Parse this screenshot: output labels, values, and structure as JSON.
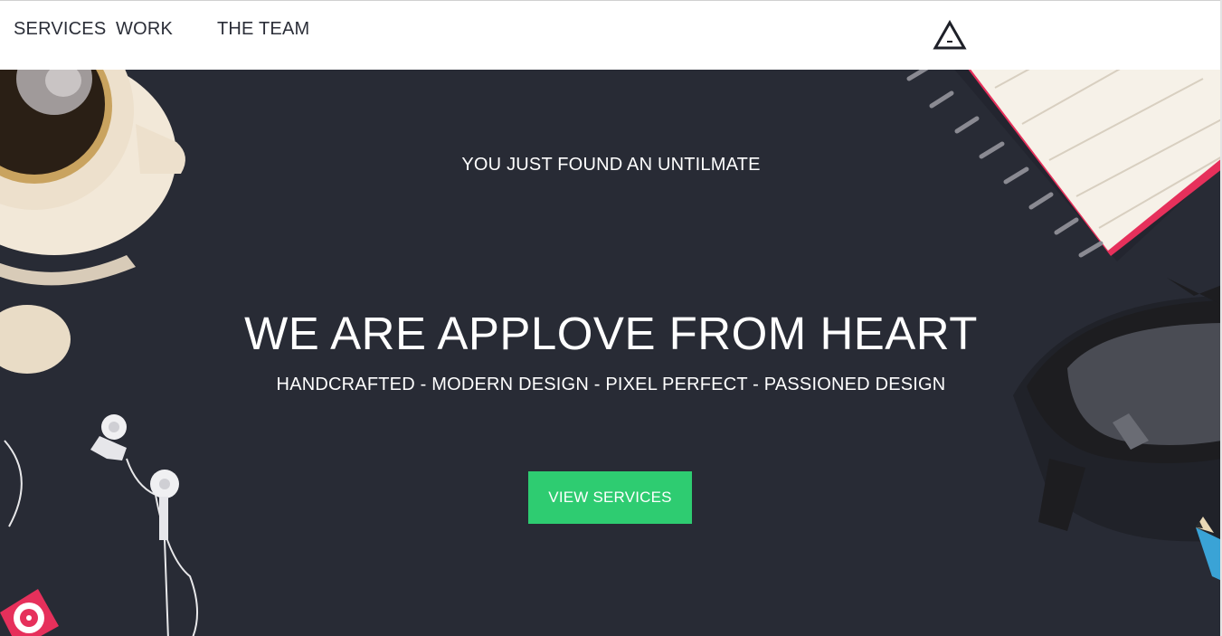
{
  "nav": {
    "items": [
      {
        "label": "SERVICES"
      },
      {
        "label": "WORK"
      },
      {
        "label": "THE TEAM"
      }
    ],
    "logo_icon": "triangle-logo-icon"
  },
  "hero": {
    "tagline": "YOU JUST FOUND AN UNTILMATE",
    "headline": "WE ARE APPLOVE FROM HEART",
    "subheading": "HANDCRAFTED - MODERN DESIGN - PIXEL PERFECT - PASSIONED DESIGN",
    "cta_label": "VIEW SERVICES",
    "background_color": "#282b35",
    "cta_color": "#2ecc71",
    "decorations": [
      "coffee-cup-icon",
      "spiral-notebook-icon",
      "eyeglasses-icon",
      "earphones-icon",
      "pencil-icon",
      "music-player-icon"
    ]
  }
}
